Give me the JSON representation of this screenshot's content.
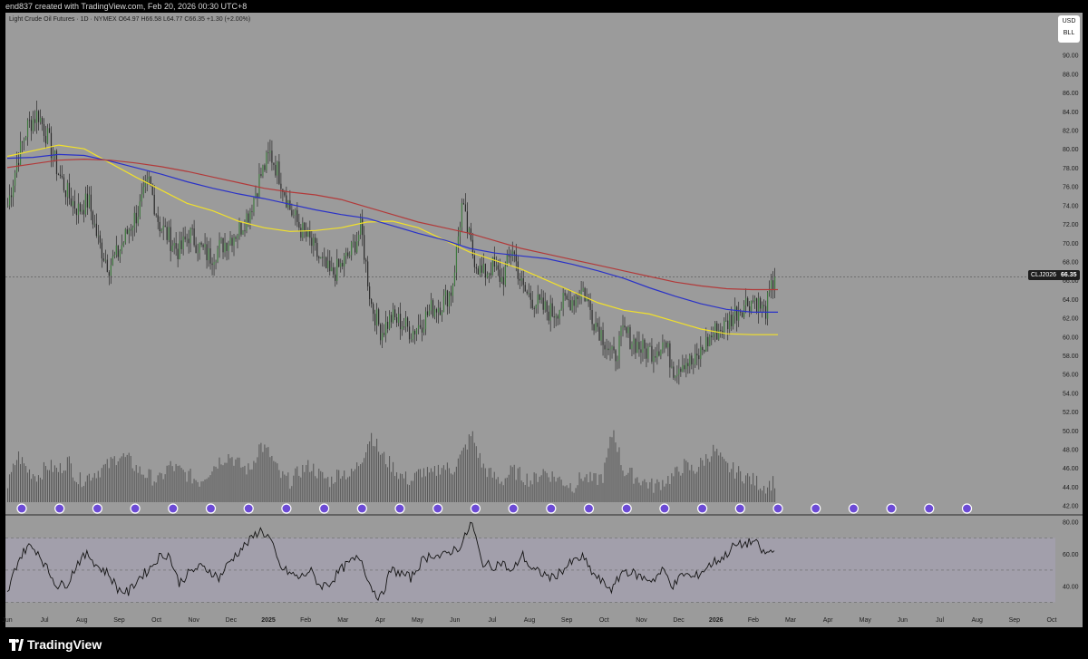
{
  "header": {
    "caption": "end837 created with TradingView.com, Feb 20, 2026 00:30 UTC+8"
  },
  "legend": {
    "text": "Light Crude Oil Futures · 1D · NYMEX  O64.97  H66.58  L64.77  C66.35  +1.30 (+2.00%)"
  },
  "currency_badge": {
    "line1": "USD",
    "line2": "BLL"
  },
  "last_price": {
    "symbol": "CLJ2026",
    "value": "66.35"
  },
  "footer": {
    "brand": "TradingView"
  },
  "colors": {
    "background": "#9b9b9b",
    "candle_body": "#2b2b2b",
    "bull_body": "#3f7a3f",
    "sma_short": "#f2e12a",
    "sma_mid": "#2a32c8",
    "sma_long": "#b23a3a",
    "volume": "#5a5a5a",
    "rsi_line": "#141414",
    "rsi_band": "#a7a3b8"
  },
  "chart_data": [
    {
      "type": "candlestick",
      "title": "Light Crude Oil Futures · 1D · NYMEX",
      "ylim": [
        41,
        92
      ],
      "y_ticks": [
        "90.00",
        "88.00",
        "86.00",
        "84.00",
        "82.00",
        "80.00",
        "78.00",
        "76.00",
        "74.00",
        "72.00",
        "70.00",
        "68.00",
        "66.00",
        "64.00",
        "62.00",
        "60.00",
        "58.00",
        "56.00",
        "54.00",
        "52.00",
        "50.00",
        "48.00",
        "46.00",
        "44.00",
        "42.00"
      ],
      "x_ticks": [
        "Jun",
        "Jul",
        "Aug",
        "Sep",
        "Oct",
        "Nov",
        "Dec",
        "2025",
        "Feb",
        "Mar",
        "Apr",
        "May",
        "Jun",
        "Jul",
        "Aug",
        "Sep",
        "Oct",
        "Nov",
        "Dec",
        "2026",
        "Feb",
        "Mar",
        "Apr",
        "May",
        "Jun",
        "Jul",
        "Aug",
        "Sep",
        "Oct"
      ],
      "close_path": [
        [
          "Jun",
          74.0
        ],
        [
          "Jun",
          79.0
        ],
        [
          "Jul",
          82.5
        ],
        [
          "Jul",
          83.8
        ],
        [
          "Jul",
          81.0
        ],
        [
          "Aug",
          77.5
        ],
        [
          "Aug",
          75.0
        ],
        [
          "Aug",
          73.5
        ],
        [
          "Aug",
          74.5
        ],
        [
          "Sep",
          70.0
        ],
        [
          "Sep",
          67.5
        ],
        [
          "Sep",
          69.0
        ],
        [
          "Sep",
          71.5
        ],
        [
          "Oct",
          73.5
        ],
        [
          "Oct",
          76.5
        ],
        [
          "Oct",
          72.0
        ],
        [
          "Oct",
          70.5
        ],
        [
          "Nov",
          69.0
        ],
        [
          "Nov",
          71.0
        ],
        [
          "Nov",
          69.5
        ],
        [
          "Dec",
          68.5
        ],
        [
          "Dec",
          69.5
        ],
        [
          "Dec",
          70.5
        ],
        [
          "Dec",
          71.5
        ],
        [
          "2025",
          73.5
        ],
        [
          "2025",
          77.0
        ],
        [
          "2025",
          79.5
        ],
        [
          "2025",
          77.0
        ],
        [
          "Feb",
          73.5
        ],
        [
          "Feb",
          71.5
        ],
        [
          "Feb",
          70.0
        ],
        [
          "Mar",
          68.0
        ],
        [
          "Mar",
          66.5
        ],
        [
          "Mar",
          67.5
        ],
        [
          "Mar",
          69.0
        ],
        [
          "Apr",
          71.5
        ],
        [
          "Apr",
          63.5
        ],
        [
          "Apr",
          60.5
        ],
        [
          "Apr",
          62.0
        ],
        [
          "May",
          61.5
        ],
        [
          "May",
          60.5
        ],
        [
          "May",
          61.5
        ],
        [
          "May",
          63.0
        ],
        [
          "Jun",
          63.5
        ],
        [
          "Jun",
          65.0
        ],
        [
          "Jun",
          74.0
        ],
        [
          "Jun",
          69.0
        ],
        [
          "Jul",
          66.5
        ],
        [
          "Jul",
          67.5
        ],
        [
          "Jul",
          66.0
        ],
        [
          "Aug",
          69.5
        ],
        [
          "Aug",
          65.0
        ],
        [
          "Aug",
          64.0
        ],
        [
          "Aug",
          63.0
        ],
        [
          "Sep",
          62.5
        ],
        [
          "Sep",
          63.5
        ],
        [
          "Sep",
          64.0
        ],
        [
          "Oct",
          65.0
        ],
        [
          "Oct",
          62.0
        ],
        [
          "Oct",
          60.0
        ],
        [
          "Oct",
          57.5
        ],
        [
          "Nov",
          60.5
        ],
        [
          "Nov",
          59.5
        ],
        [
          "Nov",
          58.5
        ],
        [
          "Nov",
          58.5
        ],
        [
          "Dec",
          59.5
        ],
        [
          "Dec",
          56.5
        ],
        [
          "Dec",
          57.5
        ],
        [
          "Dec",
          57.0
        ],
        [
          "2026",
          59.0
        ],
        [
          "2026",
          60.5
        ],
        [
          "2026",
          61.0
        ],
        [
          "2026",
          62.5
        ],
        [
          "Feb",
          63.5
        ],
        [
          "Feb",
          64.0
        ],
        [
          "Feb",
          62.5
        ],
        [
          "Feb",
          66.35
        ]
      ],
      "moving_averages": [
        {
          "values": [
            79.2,
            79.8,
            80.4,
            80.0,
            78.5,
            77.0,
            75.6,
            74.2,
            73.4,
            72.3,
            71.6,
            71.2,
            71.3,
            71.6,
            72.2,
            72.3,
            71.6,
            70.3,
            69.0,
            68.1,
            67.2,
            66.0,
            64.8,
            63.6,
            62.8,
            62.4,
            61.6,
            60.8,
            60.3,
            60.2,
            60.2
          ]
        },
        {
          "values": [
            79.0,
            79.1,
            79.4,
            79.3,
            78.7,
            78.0,
            77.3,
            76.5,
            75.8,
            75.2,
            74.7,
            74.1,
            73.5,
            73.0,
            72.6,
            71.8,
            71.0,
            70.3,
            69.4,
            68.9,
            68.6,
            68.3,
            67.7,
            67.0,
            66.2,
            65.2,
            64.3,
            63.5,
            62.9,
            62.6,
            62.6
          ]
        },
        {
          "values": [
            78.0,
            78.4,
            78.8,
            78.9,
            78.8,
            78.5,
            78.1,
            77.6,
            77.0,
            76.4,
            75.8,
            75.4,
            75.1,
            74.6,
            73.8,
            73.0,
            72.2,
            71.6,
            71.0,
            70.2,
            69.4,
            68.8,
            68.2,
            67.6,
            67.0,
            66.4,
            65.8,
            65.4,
            65.1,
            65.0,
            65.0
          ]
        }
      ]
    },
    {
      "type": "bar",
      "values": [
        44,
        50,
        47,
        46,
        48,
        47,
        49,
        45,
        46,
        47,
        48,
        50,
        49,
        47,
        46,
        45,
        48,
        47,
        46,
        45,
        47,
        49,
        50,
        48,
        47,
        52,
        50,
        46,
        45,
        47,
        48,
        46,
        45,
        47,
        46,
        49,
        54,
        50,
        48,
        46,
        45,
        47,
        46,
        48,
        47,
        50,
        54,
        48,
        46,
        45,
        47,
        46,
        45,
        47,
        46,
        45,
        44,
        46,
        45,
        46,
        55,
        47,
        46,
        45,
        44,
        45,
        46,
        48,
        47,
        49,
        51,
        48,
        47,
        46,
        45,
        44,
        45
      ]
    },
    {
      "type": "line",
      "ylim": [
        28,
        82
      ],
      "y_ticks": [
        "80.00",
        "60.00",
        "40.00"
      ],
      "bands": [
        30,
        50,
        70
      ],
      "values": [
        35,
        55,
        65,
        62,
        50,
        40,
        42,
        55,
        60,
        52,
        48,
        38,
        36,
        45,
        50,
        58,
        60,
        42,
        48,
        52,
        50,
        45,
        55,
        62,
        68,
        75,
        70,
        52,
        48,
        45,
        50,
        40,
        42,
        50,
        55,
        58,
        40,
        32,
        50,
        48,
        45,
        55,
        60,
        58,
        62,
        65,
        80,
        55,
        52,
        55,
        48,
        60,
        50,
        48,
        45,
        50,
        55,
        58,
        48,
        42,
        38,
        50,
        48,
        45,
        44,
        50,
        40,
        48,
        45,
        50,
        55,
        58,
        65,
        66,
        68,
        60,
        62
      ]
    }
  ]
}
